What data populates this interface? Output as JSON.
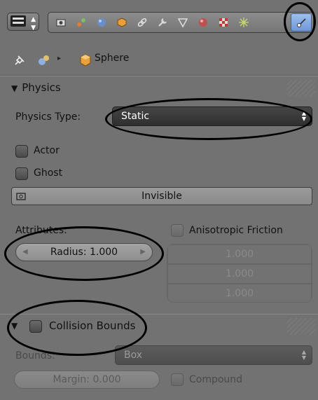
{
  "breadcrumb": {
    "object_name": "Sphere"
  },
  "physics_panel": {
    "title": "Physics",
    "physics_type_label": "Physics Type:",
    "physics_type_value": "Static",
    "actor_label": "Actor",
    "ghost_label": "Ghost",
    "invisible_label": "Invisible",
    "attributes_label": "Attributes:",
    "radius_field": "Radius: 1.000",
    "anisotropic_label": "Anisotropic Friction",
    "friction_values": [
      "1.000",
      "1.000",
      "1.000"
    ]
  },
  "collision_panel": {
    "title": "Collision Bounds",
    "bounds_label": "Bounds:",
    "bounds_value": "Box",
    "margin_field": "Margin: 0.000",
    "compound_label": "Compound"
  },
  "icons": [
    "editor-type-icon",
    "render-icon",
    "scene-icon",
    "world-icon",
    "object-icon",
    "constraints-icon",
    "modifiers-icon",
    "data-icon",
    "material-icon",
    "texture-icon",
    "particles-icon",
    "physics-icon",
    "pin-icon",
    "object-data-icon",
    "cube-icon"
  ],
  "colors": {
    "panel_bg": "#727272",
    "active_tab": "#8fb3ea",
    "dropdown_bg": "#3a3a3a"
  }
}
